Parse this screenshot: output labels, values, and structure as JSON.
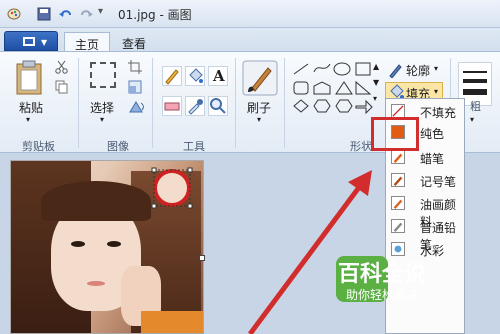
{
  "window": {
    "title": "01.jpg - 画图"
  },
  "tabs": [
    {
      "label": "主页",
      "active": true
    },
    {
      "label": "查看",
      "active": false
    }
  ],
  "groups": {
    "clipboard": {
      "label": "剪贴板",
      "paste_label": "粘贴"
    },
    "image": {
      "label": "图像",
      "select_label": "选择"
    },
    "tools": {
      "label": "工具"
    },
    "brushes": {
      "label": "刷子"
    },
    "shapes": {
      "label": "形状",
      "outline_label": "轮廓",
      "fill_label": "填充"
    },
    "size": {
      "label": "粗"
    }
  },
  "fill_menu": {
    "items": [
      {
        "label": "不填充",
        "swatch": "#ffffff"
      },
      {
        "label": "纯色",
        "swatch": "#e25b12"
      },
      {
        "label": "蜡笔",
        "swatch": "#ffffff"
      },
      {
        "label": "记号笔",
        "swatch": "#ffffff"
      },
      {
        "label": "油画颜料",
        "swatch": "#ffffff"
      },
      {
        "label": "普通铅笔",
        "swatch": "#ffffff"
      },
      {
        "label": "水彩",
        "swatch": "#ffffff"
      }
    ],
    "highlighted_item": "纯色"
  },
  "watermark": {
    "title": "百科全说",
    "subtitle": "助你轻松解决"
  },
  "colors": {
    "accent": "#1d4fa6",
    "highlight_box": "#d12d2d",
    "arrow": "#d12d2d",
    "fill_swatch": "#e25b12",
    "watermark_bg": "#5ab043"
  }
}
